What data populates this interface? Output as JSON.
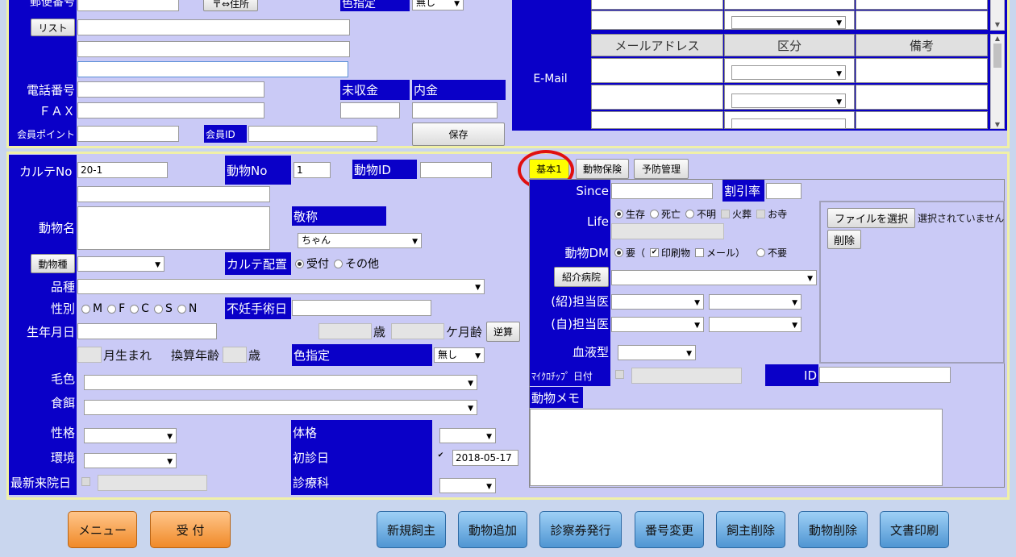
{
  "top": {
    "postal_label": "郵便番号",
    "postal_btn": "〒⇔住所",
    "color_label": "色指定",
    "color_value": "無し",
    "list_btn": "リスト",
    "phone_label": "電話番号",
    "fax_label": "ＦＡＸ",
    "points_label": "会員ポイント",
    "member_id_label": "会員ID",
    "unpaid_label": "未収金",
    "deposit_label": "内金",
    "save_btn": "保存",
    "email_label": "E-Mail",
    "email_headers": [
      "メールアドレス",
      "区分",
      "備考"
    ]
  },
  "animal": {
    "chart_no_label": "カルテNo",
    "chart_no_value": "20-1",
    "animal_no_label": "動物No",
    "animal_no_value": "1",
    "animal_id_label": "動物ID",
    "name_label": "動物名",
    "honorific_label": "敬称",
    "honorific_value": "ちゃん",
    "species_btn": "動物種",
    "chart_place_label": "カルテ配置",
    "chart_place_opts": [
      "受付",
      "その他"
    ],
    "breed_label": "品種",
    "sex_label": "性別",
    "sex_opts": [
      "M",
      "F",
      "C",
      "S",
      "N"
    ],
    "neuter_label": "不妊手術日",
    "birth_label": "生年月日",
    "age_unit": "歳",
    "month_age_unit": "ケ月齢",
    "reverse_btn": "逆算",
    "month_born_label": "月生まれ",
    "conv_age_label": "換算年齢",
    "conv_age_unit": "歳",
    "color_label": "色指定",
    "color_value": "無し",
    "coat_label": "毛色",
    "food_label": "食餌",
    "temper_label": "性格",
    "env_label": "環境",
    "last_visit_label": "最新来院日",
    "build_label": "体格",
    "first_visit_label": "初診日",
    "first_visit_value": "2018-05-17",
    "dept_label": "診療科"
  },
  "tabs": [
    "基本1",
    "動物保険",
    "予防管理"
  ],
  "right": {
    "since_label": "Since",
    "discount_label": "割引率",
    "life_label": "Life",
    "life_opts": [
      "生存",
      "死亡",
      "不明",
      "火葬",
      "お寺"
    ],
    "file_btn": "ファイルを選択",
    "file_status": "選択されていません",
    "delete_btn": "削除",
    "dm_label": "動物DM",
    "dm_opts": [
      "要（",
      "印刷物",
      "メール）",
      "不要"
    ],
    "referral_btn": "紹介病院",
    "ref_doctor_label": "(紹)担当医",
    "own_doctor_label": "(自)担当医",
    "blood_label": "血液型",
    "chip_label": "ﾏｲｸﾛﾁｯﾌﾟ 日付",
    "id_label": "ID",
    "memo_label": "動物メモ"
  },
  "bottom_buttons": {
    "menu": "メニュー",
    "reception": "受 付",
    "new_owner": "新規飼主",
    "add_animal": "動物追加",
    "issue_card": "診察券発行",
    "change_no": "番号変更",
    "delete_owner": "飼主削除",
    "delete_animal": "動物削除",
    "print_docs": "文書印刷"
  }
}
